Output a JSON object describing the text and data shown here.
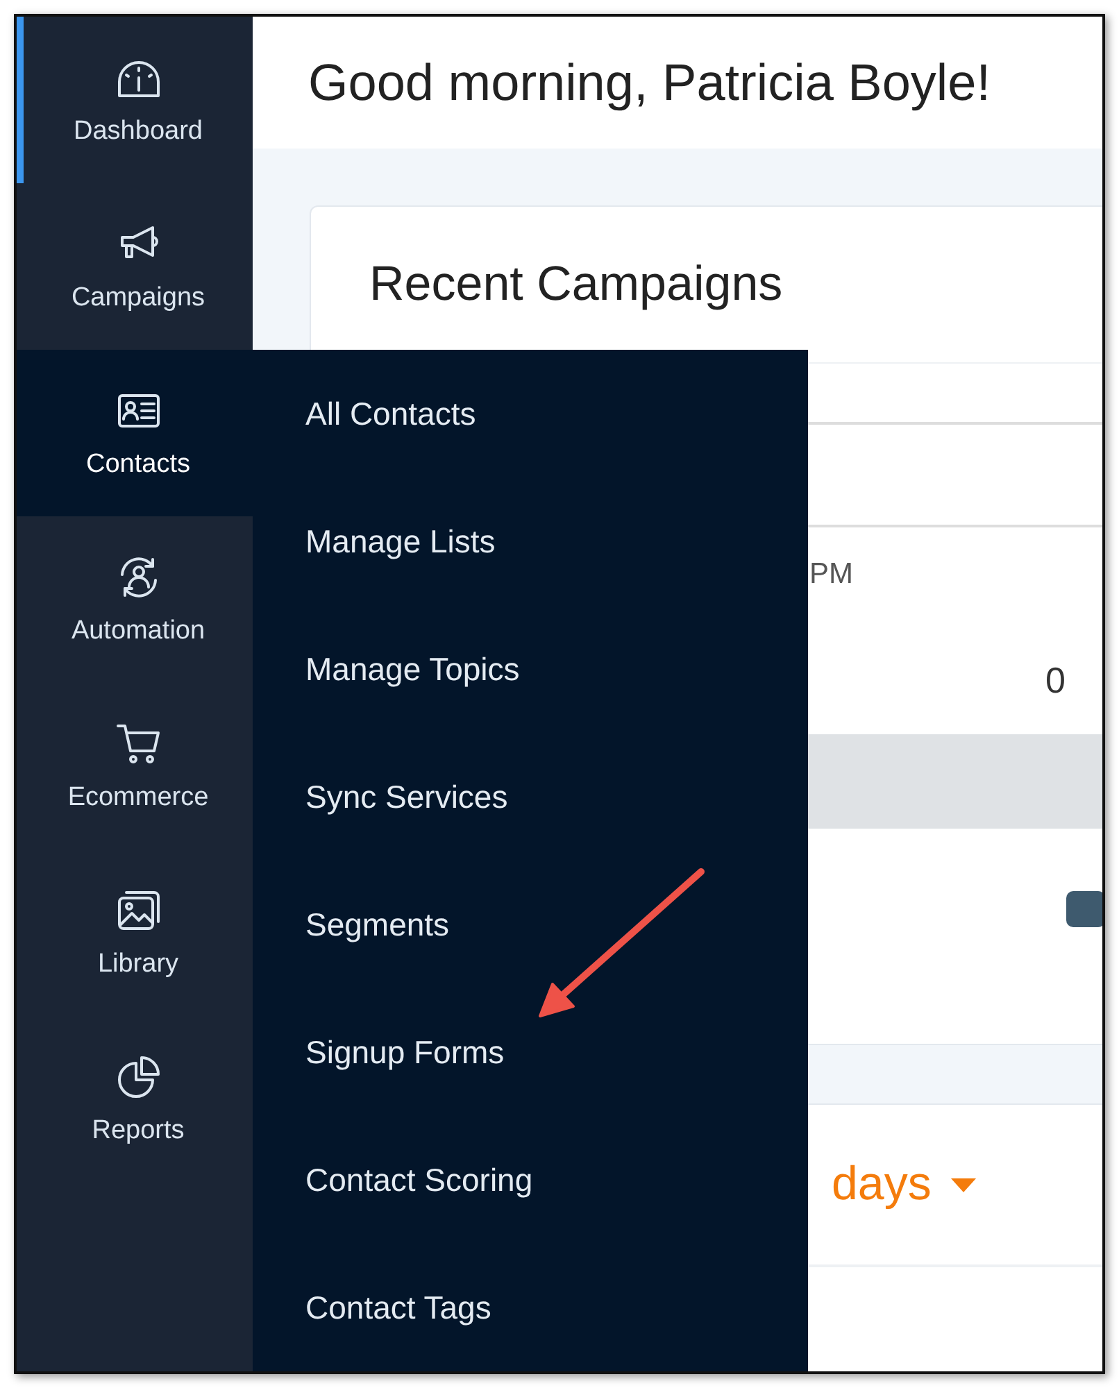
{
  "sidebar": {
    "items": [
      {
        "label": "Dashboard",
        "current": true,
        "selected": false
      },
      {
        "label": "Campaigns",
        "current": false,
        "selected": false
      },
      {
        "label": "Contacts",
        "current": false,
        "selected": true
      },
      {
        "label": "Automation",
        "current": false,
        "selected": false
      },
      {
        "label": "Ecommerce",
        "current": false,
        "selected": false
      },
      {
        "label": "Library",
        "current": false,
        "selected": false
      },
      {
        "label": "Reports",
        "current": false,
        "selected": false
      }
    ]
  },
  "flyout_menu": {
    "items": [
      "All Contacts",
      "Manage Lists",
      "Manage Topics",
      "Sync Services",
      "Segments",
      "Signup Forms",
      "Contact Scoring",
      "Contact Tags"
    ]
  },
  "header": {
    "greeting": "Good morning, Patricia Boyle!"
  },
  "recent_campaigns": {
    "title": "Recent Campaigns",
    "time_fragment": "PM",
    "count_fragment": "0"
  },
  "period_card": {
    "period": "days"
  }
}
